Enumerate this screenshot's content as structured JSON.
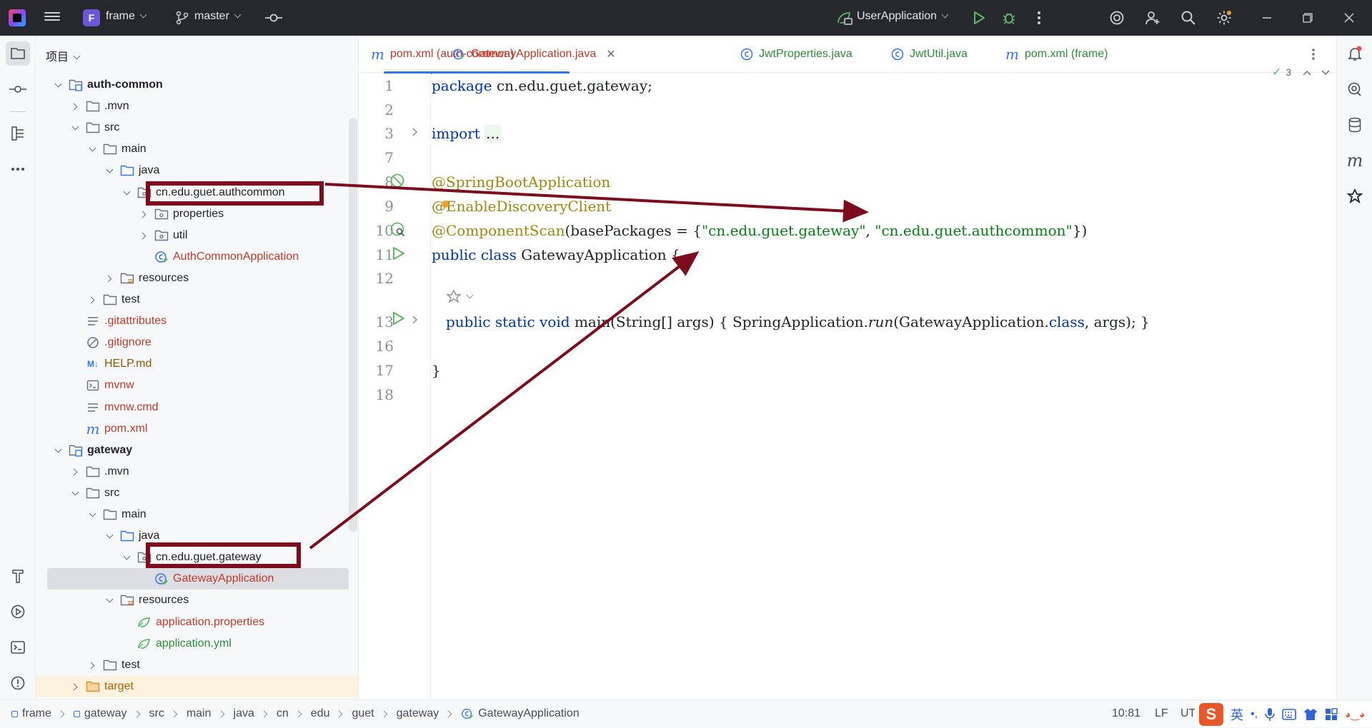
{
  "titlebar": {
    "project_badge": "F",
    "project_name": "frame",
    "branch": "master",
    "run_config": "UserApplication"
  },
  "project_panel": {
    "header": "项目",
    "rows": [
      {
        "label": "auth-common",
        "depth": 1,
        "arrow": "open",
        "icon": "module-folder",
        "style": "bold"
      },
      {
        "label": ".mvn",
        "depth": 2,
        "arrow": "closed",
        "icon": "folder",
        "style": ""
      },
      {
        "label": "src",
        "depth": 2,
        "arrow": "open",
        "icon": "folder",
        "style": ""
      },
      {
        "label": "main",
        "depth": 3,
        "arrow": "open",
        "icon": "folder",
        "style": ""
      },
      {
        "label": "java",
        "depth": 4,
        "arrow": "open",
        "icon": "source-folder",
        "style": ""
      },
      {
        "label": "cn.edu.guet.authcommon",
        "depth": 5,
        "arrow": "open",
        "icon": "package",
        "style": ""
      },
      {
        "label": "properties",
        "depth": 6,
        "arrow": "closed",
        "icon": "package",
        "style": ""
      },
      {
        "label": "util",
        "depth": 6,
        "arrow": "closed",
        "icon": "package",
        "style": ""
      },
      {
        "label": "AuthCommonApplication",
        "depth": 6,
        "arrow": "none",
        "icon": "spring-class",
        "style": "red"
      },
      {
        "label": "resources",
        "depth": 4,
        "arrow": "closed",
        "icon": "resources-folder",
        "style": ""
      },
      {
        "label": "test",
        "depth": 3,
        "arrow": "closed",
        "icon": "folder",
        "style": ""
      },
      {
        "label": ".gitattributes",
        "depth": 2,
        "arrow": "none",
        "icon": "text-file",
        "style": "red"
      },
      {
        "label": ".gitignore",
        "depth": 2,
        "arrow": "none",
        "icon": "ignore-file",
        "style": "red"
      },
      {
        "label": "HELP.md",
        "depth": 2,
        "arrow": "none",
        "icon": "markdown-file",
        "style": "brown"
      },
      {
        "label": "mvnw",
        "depth": 2,
        "arrow": "none",
        "icon": "shell-file",
        "style": "red"
      },
      {
        "label": "mvnw.cmd",
        "depth": 2,
        "arrow": "none",
        "icon": "text-file",
        "style": "red"
      },
      {
        "label": "pom.xml",
        "depth": 2,
        "arrow": "none",
        "icon": "maven-file",
        "style": "red"
      },
      {
        "label": "gateway",
        "depth": 1,
        "arrow": "open",
        "icon": "module-folder",
        "style": "bold"
      },
      {
        "label": ".mvn",
        "depth": 2,
        "arrow": "closed",
        "icon": "folder",
        "style": ""
      },
      {
        "label": "src",
        "depth": 2,
        "arrow": "open",
        "icon": "folder",
        "style": ""
      },
      {
        "label": "main",
        "depth": 3,
        "arrow": "open",
        "icon": "folder",
        "style": ""
      },
      {
        "label": "java",
        "depth": 4,
        "arrow": "open",
        "icon": "source-folder",
        "style": ""
      },
      {
        "label": "cn.edu.guet.gateway",
        "depth": 5,
        "arrow": "open",
        "icon": "package",
        "style": ""
      },
      {
        "label": "GatewayApplication",
        "depth": 6,
        "arrow": "none",
        "icon": "spring-class",
        "style": "red",
        "selected": true
      },
      {
        "label": "resources",
        "depth": 4,
        "arrow": "open",
        "icon": "resources-folder",
        "style": ""
      },
      {
        "label": "application.properties",
        "depth": 5,
        "arrow": "none",
        "icon": "spring-config",
        "style": "red"
      },
      {
        "label": "application.yml",
        "depth": 5,
        "arrow": "none",
        "icon": "spring-config",
        "style": "green"
      },
      {
        "label": "test",
        "depth": 3,
        "arrow": "closed",
        "icon": "folder",
        "style": ""
      },
      {
        "label": "target",
        "depth": 2,
        "arrow": "closed",
        "icon": "excluded-folder",
        "style": "target"
      }
    ]
  },
  "tabs": [
    {
      "label": "pom.xml (auth-common)",
      "icon": "maven-icon",
      "color": "#c0392b",
      "active": false
    },
    {
      "label": "GatewayApplication.java",
      "icon": "spring-class-icon",
      "color": "#c0392b",
      "active": true
    },
    {
      "label": "JwtProperties.java",
      "icon": "class-icon",
      "color": "#2e8b3a",
      "active": false
    },
    {
      "label": "JwtUtil.java",
      "icon": "class-icon",
      "color": "#2e8b3a",
      "active": false
    },
    {
      "label": "pom.xml (frame)",
      "icon": "maven-icon",
      "color": "#2e8b3a",
      "active": false
    }
  ],
  "editor": {
    "inspection_count": "3",
    "line_numbers": [
      "1",
      "2",
      "3",
      "7",
      "8",
      "9",
      "10",
      "11",
      "12",
      "13",
      "16",
      "17",
      "18"
    ],
    "lines": {
      "l1_kw": "package",
      "l1_rest": " cn.edu.guet.gateway;",
      "l3_kw": "import",
      "l3_fold": "...",
      "l8": "@SpringBootApplication",
      "l9": "@EnableDiscoveryClient",
      "l10_ann": "@ComponentScan",
      "l10_a": "(basePackages = {",
      "l10_s1": "\"cn.edu.guet.gateway\"",
      "l10_b": ", ",
      "l10_s2": "\"cn.edu.guet.authcommon\"",
      "l10_c": "})",
      "l11_kw": "public class",
      "l11_rest": " GatewayApplication {",
      "l13_kw": "public static void",
      "l13_a": " main(String[] args) { SpringApplication.",
      "l13_run": "run",
      "l13_b": "(GatewayApplication.",
      "l13_cls": "class",
      "l13_c": ", args); }",
      "l17": "}"
    }
  },
  "statusbar": {
    "breadcrumbs": [
      "frame",
      "gateway",
      "src",
      "main",
      "java",
      "cn",
      "edu",
      "guet",
      "gateway",
      "GatewayApplication"
    ],
    "position": "10:81",
    "line_ending": "LF",
    "encoding": "UT",
    "ime_lang": "英"
  },
  "colors": {
    "annotation_box": "#7b0d1e",
    "accent": "#3574f0"
  }
}
